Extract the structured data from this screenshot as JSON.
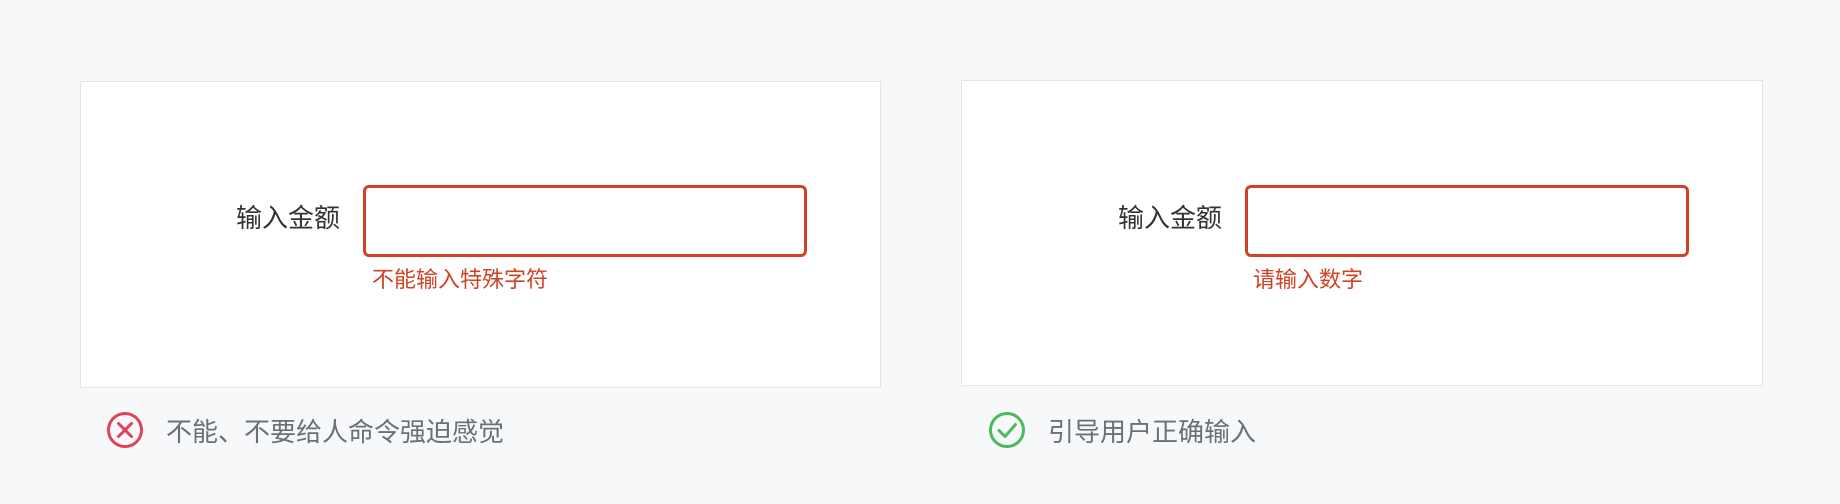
{
  "examples": {
    "bad": {
      "field_label": "输入金额",
      "error_message": "不能输入特殊字符",
      "caption": "不能、不要给人命令强迫感觉",
      "icon": "x-circle-icon",
      "icon_color": "#e0425a"
    },
    "good": {
      "field_label": "输入金额",
      "error_message": "请输入数字",
      "caption": "引导用户正确输入",
      "icon": "check-circle-icon",
      "icon_color": "#4cb95e"
    }
  },
  "colors": {
    "error": "#cf4325",
    "background": "#f7f8fa",
    "panel": "#ffffff",
    "caption_text": "#6b6f77"
  }
}
